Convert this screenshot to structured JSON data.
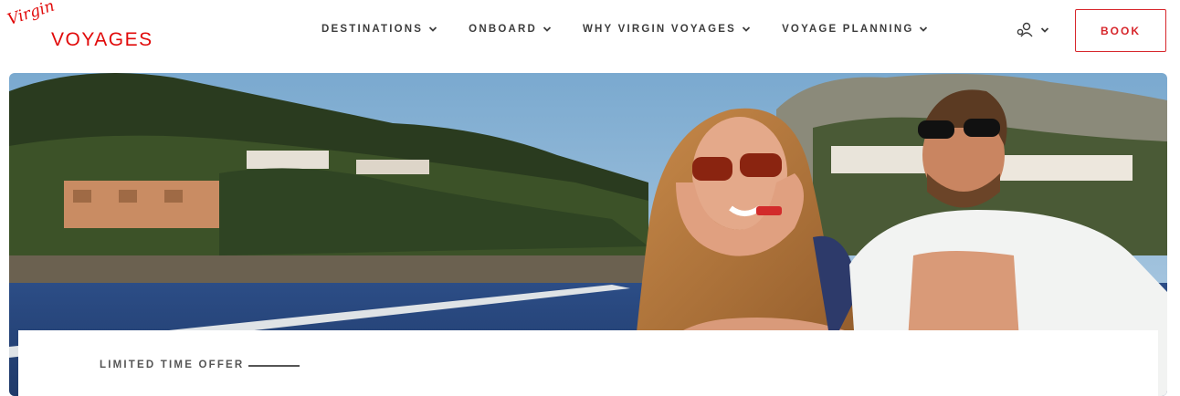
{
  "brand": {
    "logo_script": "Virgin",
    "logo_word": "VOYAGES",
    "color": "#e10a0a"
  },
  "nav": {
    "items": [
      {
        "label": "DESTINATIONS",
        "icon": "chevron-down-icon"
      },
      {
        "label": "ONBOARD",
        "icon": "chevron-down-icon"
      },
      {
        "label": "WHY VIRGIN VOYAGES",
        "icon": "chevron-down-icon"
      },
      {
        "label": "VOYAGE PLANNING",
        "icon": "chevron-down-icon"
      }
    ]
  },
  "account": {
    "icon": "user-account-icon",
    "chevron": "chevron-down-icon"
  },
  "book": {
    "label": "BOOK",
    "color": "#d7262b"
  },
  "hero": {
    "image": "couple-on-boat-photo",
    "offer_label": "LIMITED TIME OFFER"
  }
}
